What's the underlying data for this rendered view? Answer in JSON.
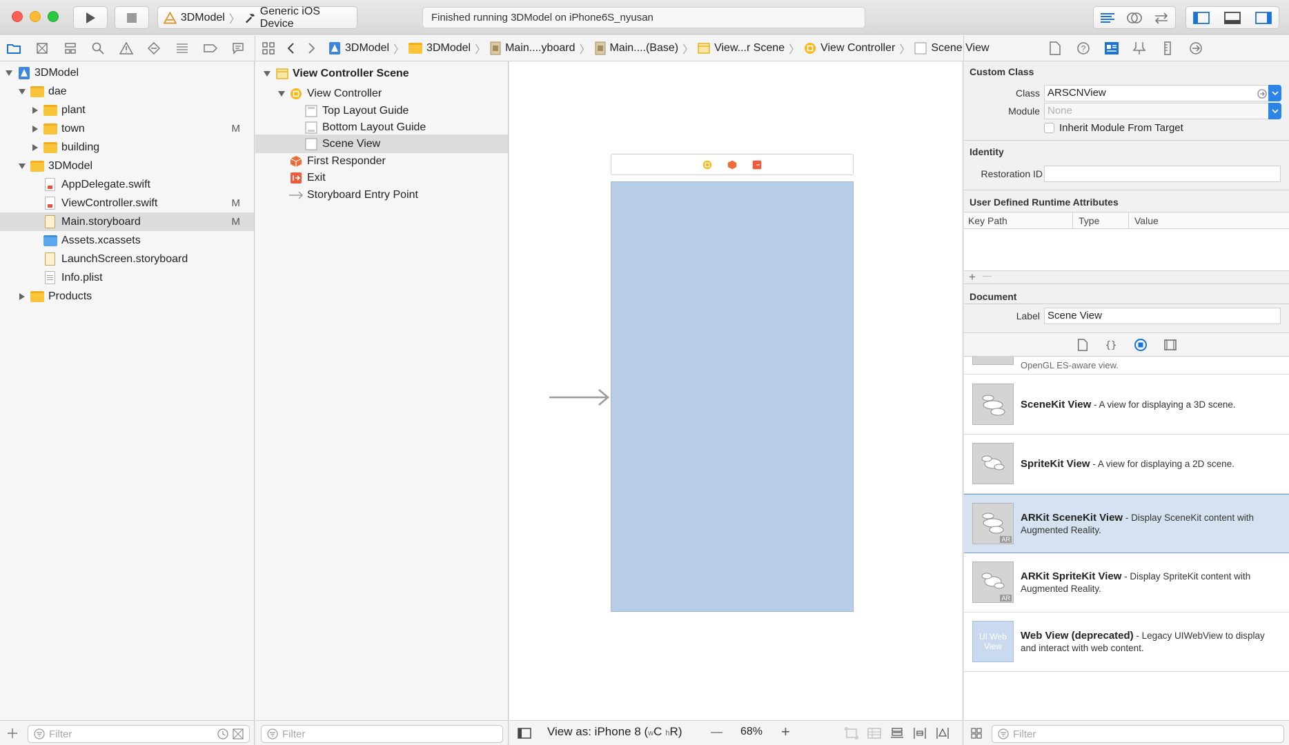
{
  "toolbar": {
    "scheme_name": "3DModel",
    "device_name": "Generic iOS Device",
    "activity_status": "Finished running 3DModel on iPhone6S_nyusan"
  },
  "jump_bar": [
    "3DModel",
    "3DModel",
    "Main....yboard",
    "Main....(Base)",
    "View...r Scene",
    "View Controller",
    "Scene View"
  ],
  "navigator": {
    "items": [
      {
        "label": "3DModel",
        "badge": ""
      },
      {
        "label": "dae",
        "badge": ""
      },
      {
        "label": "plant",
        "badge": ""
      },
      {
        "label": "town",
        "badge": "M"
      },
      {
        "label": "building",
        "badge": ""
      },
      {
        "label": "3DModel",
        "badge": ""
      },
      {
        "label": "AppDelegate.swift",
        "badge": ""
      },
      {
        "label": "ViewController.swift",
        "badge": "M"
      },
      {
        "label": "Main.storyboard",
        "badge": "M"
      },
      {
        "label": "Assets.xcassets",
        "badge": ""
      },
      {
        "label": "LaunchScreen.storyboard",
        "badge": ""
      },
      {
        "label": "Info.plist",
        "badge": ""
      },
      {
        "label": "Products",
        "badge": ""
      }
    ],
    "filter_placeholder": "Filter"
  },
  "outline": {
    "items": [
      "View Controller Scene",
      "View Controller",
      "Top Layout Guide",
      "Bottom Layout Guide",
      "Scene View",
      "First Responder",
      "Exit",
      "Storyboard Entry Point"
    ],
    "filter_placeholder": "Filter"
  },
  "canvas_bar": {
    "view_as_prefix": "View as: iPhone 8 (",
    "w_small": "w",
    "c": "C",
    "h_small": "h",
    "r": "R",
    "close_paren": ")",
    "zoom_out": "—",
    "zoom": "68%",
    "zoom_in": "+"
  },
  "inspector": {
    "custom_class": {
      "title": "Custom Class",
      "class_label": "Class",
      "class_value": "ARSCNView",
      "module_label": "Module",
      "module_placeholder": "None",
      "inherit_label": "Inherit Module From Target"
    },
    "identity": {
      "title": "Identity",
      "restoration_label": "Restoration ID"
    },
    "runtime": {
      "title": "User Defined Runtime Attributes",
      "col_keypath": "Key Path",
      "col_type": "Type",
      "col_value": "Value",
      "add": "+",
      "remove": "—"
    },
    "document": {
      "title": "Document",
      "label_label": "Label",
      "label_value": "Scene View"
    }
  },
  "library": {
    "partial_top": "OpenGL ES-aware view.",
    "items": [
      {
        "title": "SceneKit View",
        "desc": " - A view for displaying a 3D scene.",
        "badge": ""
      },
      {
        "title": "SpriteKit View",
        "desc": " - A view for displaying a 2D scene.",
        "badge": ""
      },
      {
        "title": "ARKit SceneKit View",
        "desc": " - Display SceneKit content with Augmented Reality.",
        "badge": "AR"
      },
      {
        "title": "ARKit SpriteKit View",
        "desc": " - Display SpriteKit content with Augmented Reality.",
        "badge": "AR"
      },
      {
        "title": "Web View (deprecated)",
        "desc": " - Legacy UIWebView to display and interact with web content.",
        "badge": "UI Web View"
      }
    ],
    "filter_placeholder": "Filter"
  },
  "colors": {
    "accent": "#1a73d9",
    "scene_view_fill": "#b8cde6",
    "folder": "#f9c43a",
    "selection": "#dcdcdc",
    "library_selection": "#d6e2f2"
  }
}
